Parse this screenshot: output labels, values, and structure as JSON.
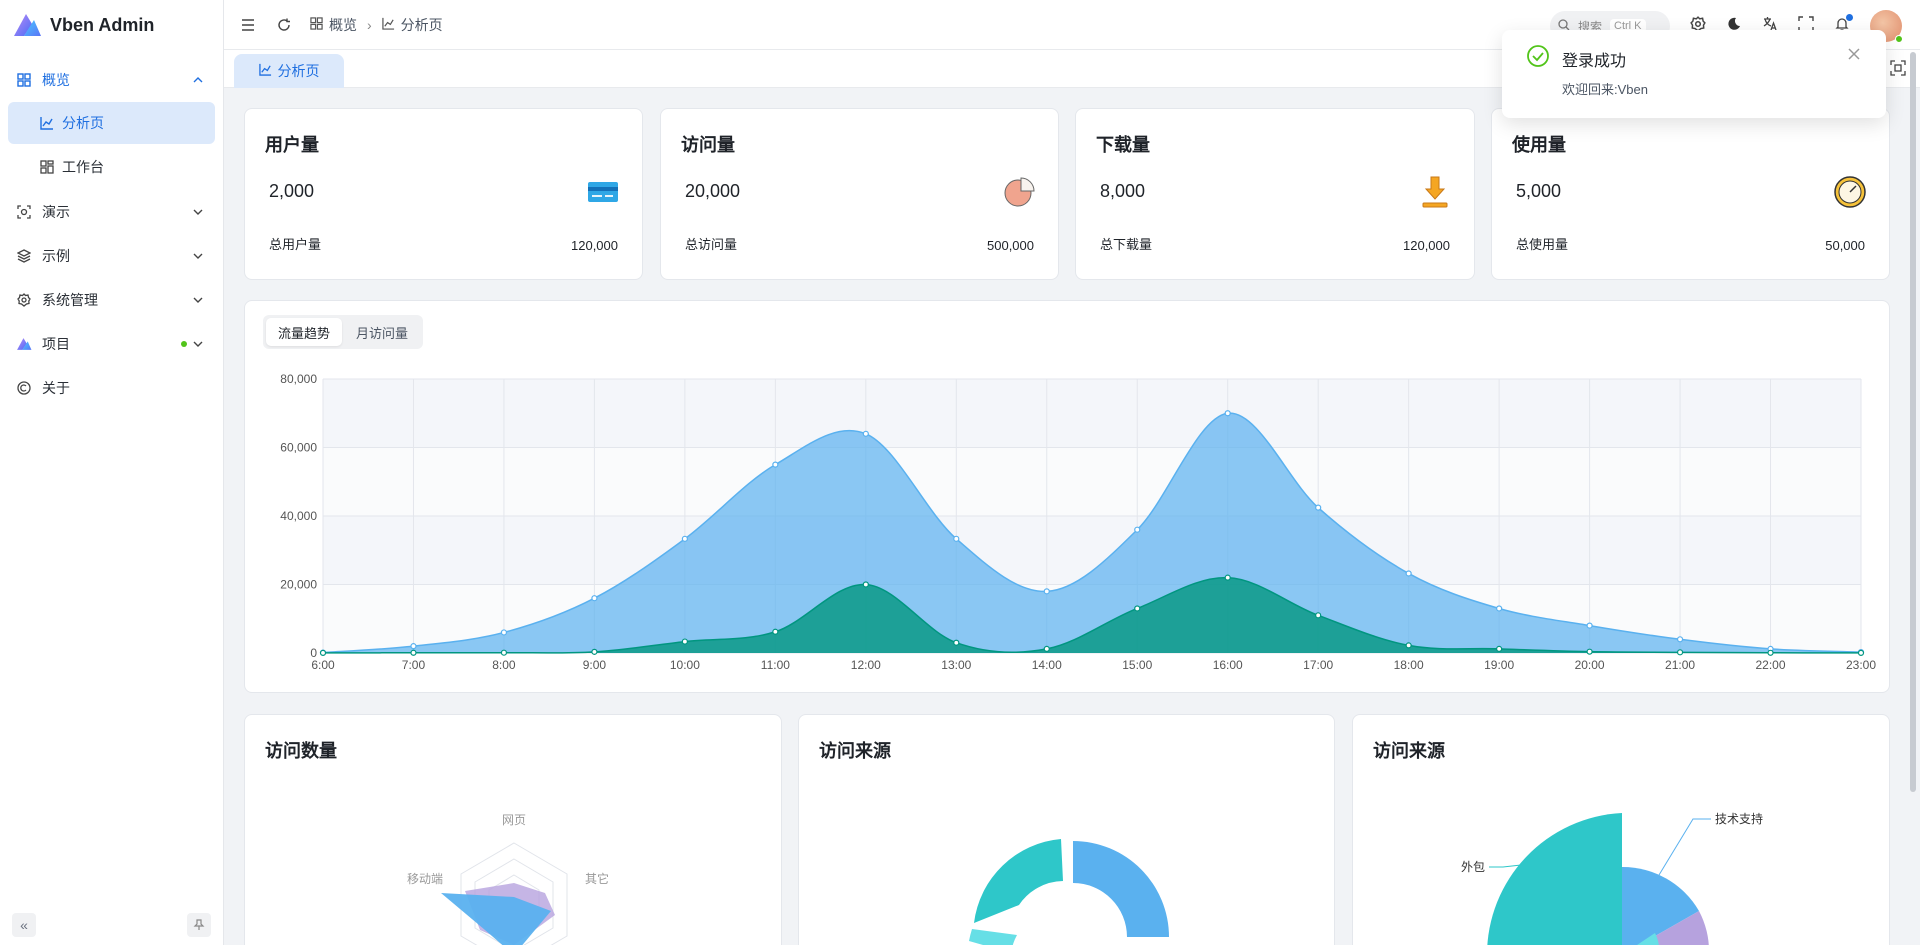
{
  "app": {
    "title": "Vben Admin"
  },
  "sidebar": {
    "items": [
      {
        "label": "概览",
        "icon": "dashboard-icon",
        "expanded": true,
        "children": [
          {
            "label": "分析页",
            "icon": "chart-line-icon",
            "active": true
          },
          {
            "label": "工作台",
            "icon": "workspace-icon",
            "active": false
          }
        ]
      },
      {
        "label": "演示",
        "icon": "demo-icon"
      },
      {
        "label": "示例",
        "icon": "layers-icon"
      },
      {
        "label": "系统管理",
        "icon": "gear-icon"
      },
      {
        "label": "项目",
        "icon": "vben-logo-icon",
        "badge_dot": true
      },
      {
        "label": "关于",
        "icon": "copyright-icon"
      }
    ]
  },
  "header": {
    "breadcrumb": [
      {
        "label": "概览",
        "icon": "dashboard-icon"
      },
      {
        "label": "分析页",
        "icon": "chart-line-icon"
      }
    ],
    "search": {
      "placeholder": "搜索",
      "shortcut": "Ctrl K"
    }
  },
  "tabs": [
    {
      "label": "分析页",
      "icon": "chart-line-icon",
      "active": true
    }
  ],
  "stats": [
    {
      "title": "用户量",
      "value": "2,000",
      "total_label": "总用户量",
      "total_value": "120,000",
      "icon": "card-icon"
    },
    {
      "title": "访问量",
      "value": "20,000",
      "total_label": "总访问量",
      "total_value": "500,000",
      "icon": "pie-icon"
    },
    {
      "title": "下载量",
      "value": "8,000",
      "total_label": "总下载量",
      "total_value": "120,000",
      "icon": "download-icon"
    },
    {
      "title": "使用量",
      "value": "5,000",
      "total_label": "总使用量",
      "total_value": "50,000",
      "icon": "clock-icon"
    }
  ],
  "chart_tabs": [
    {
      "label": "流量趋势",
      "active": true
    },
    {
      "label": "月访问量",
      "active": false
    }
  ],
  "chart_data": [
    {
      "type": "area",
      "x": [
        "6:00",
        "7:00",
        "8:00",
        "9:00",
        "10:00",
        "11:00",
        "12:00",
        "13:00",
        "14:00",
        "15:00",
        "16:00",
        "17:00",
        "18:00",
        "19:00",
        "20:00",
        "21:00",
        "22:00",
        "23:00"
      ],
      "series": [
        {
          "values": [
            111,
            2000,
            6000,
            16000,
            33333,
            55000,
            64000,
            33333,
            18000,
            36000,
            70000,
            42444,
            23222,
            13000,
            8000,
            4000,
            1200,
            280
          ],
          "color": "#5ab1ef"
        },
        {
          "values": [
            33,
            66,
            88,
            333,
            3333,
            6200,
            20000,
            3000,
            1200,
            13000,
            22000,
            11000,
            2221,
            1201,
            390,
            198,
            60,
            30
          ],
          "color": "#019680"
        }
      ],
      "ylim": [
        0,
        80000
      ],
      "yticks": [
        "0",
        "20,000",
        "40,000",
        "60,000",
        "80,000"
      ],
      "grid": true
    },
    {
      "type": "radar",
      "indicators": [
        "网页",
        "其它",
        "移动端"
      ]
    },
    {
      "type": "pie"
    },
    {
      "type": "pie",
      "labels": [
        "技术支持",
        "外包"
      ]
    }
  ],
  "bottom_cards": [
    {
      "title": "访问数量"
    },
    {
      "title": "访问来源"
    },
    {
      "title": "访问来源"
    }
  ],
  "toast": {
    "title": "登录成功",
    "message": "欢迎回来:Vben",
    "type": "success"
  },
  "colors": {
    "accent": "#1f6fe0",
    "area1": "#5ab1ef",
    "area2": "#019680",
    "success": "#52c41a"
  }
}
